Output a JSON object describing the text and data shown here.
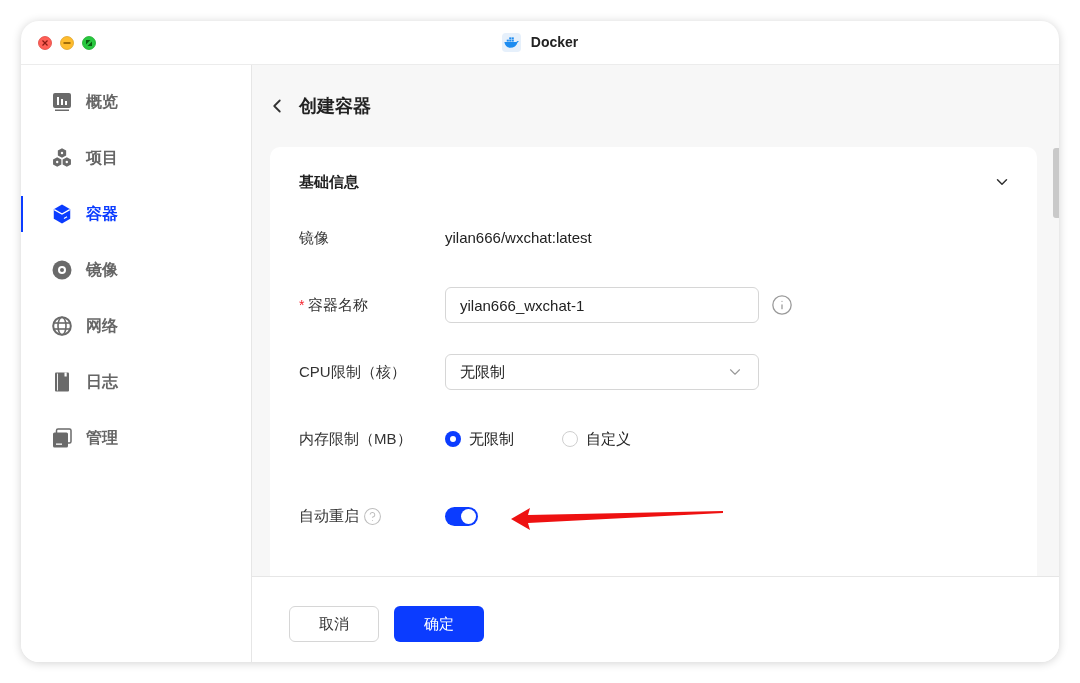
{
  "window": {
    "title": "Docker"
  },
  "sidebar": {
    "items": [
      {
        "label": "概览",
        "selected": false
      },
      {
        "label": "项目",
        "selected": false
      },
      {
        "label": "容器",
        "selected": true
      },
      {
        "label": "镜像",
        "selected": false
      },
      {
        "label": "网络",
        "selected": false
      },
      {
        "label": "日志",
        "selected": false
      },
      {
        "label": "管理",
        "selected": false
      }
    ]
  },
  "page": {
    "title": "创建容器"
  },
  "section": {
    "title": "基础信息",
    "expanded": true,
    "fields": [
      {
        "kind": "text",
        "label": "镜像",
        "value": "yilan666/wxchat:latest"
      },
      {
        "kind": "input",
        "label": "容器名称",
        "required_mark": "*",
        "value": "yilan666_wxchat-1"
      },
      {
        "kind": "select",
        "label": "CPU限制（核）",
        "value": "无限制"
      },
      {
        "kind": "radio",
        "label": "内存限制（MB）",
        "options": [
          {
            "label": "无限制",
            "selected": true
          },
          {
            "label": "自定义",
            "selected": false
          }
        ]
      },
      {
        "kind": "toggle",
        "label": "自动重启",
        "on": true
      }
    ]
  },
  "buttons": [
    {
      "kind": "secondary",
      "label": "取消"
    },
    {
      "kind": "primary",
      "label": "确定"
    }
  ]
}
